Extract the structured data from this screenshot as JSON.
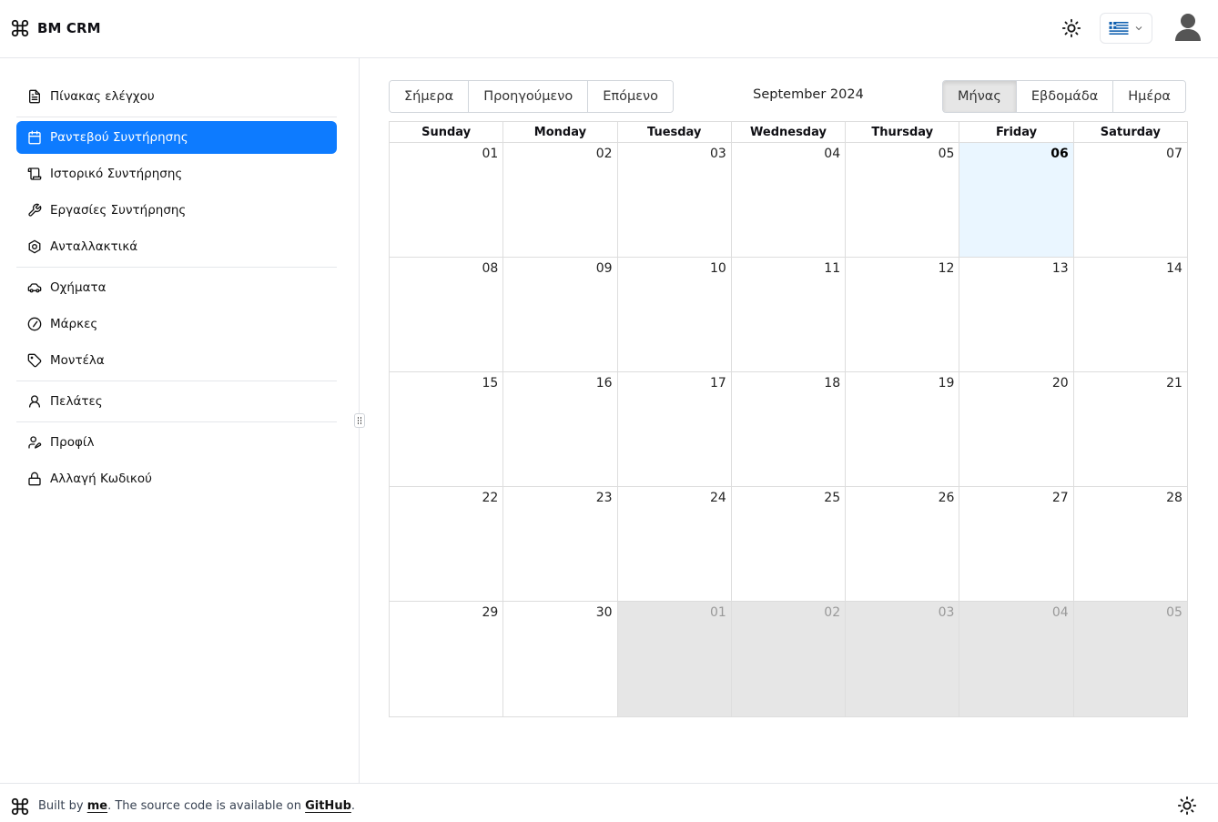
{
  "header": {
    "brand": "BM CRM",
    "theme_icon": "sun-icon",
    "language_icon": "greek-flag-icon",
    "avatar_icon": "user-avatar-icon"
  },
  "sidebar": {
    "items": [
      {
        "label": "Πίνακας ελέγχου",
        "icon": "file-text-icon"
      },
      {
        "label": "Ραντεβού Συντήρησης",
        "icon": "calendar-icon",
        "active": true
      },
      {
        "label": "Ιστορικό Συντήρησης",
        "icon": "scroll-icon"
      },
      {
        "label": "Εργασίες Συντήρησης",
        "icon": "wrench-icon"
      },
      {
        "label": "Ανταλλακτικά",
        "icon": "hexagon-nut-icon"
      },
      {
        "label": "Οχήματα",
        "icon": "car-icon"
      },
      {
        "label": "Μάρκες",
        "icon": "compass-icon"
      },
      {
        "label": "Μοντέλα",
        "icon": "tag-icon"
      },
      {
        "label": "Πελάτες",
        "icon": "user-icon"
      },
      {
        "label": "Προφίλ",
        "icon": "user-pen-icon"
      },
      {
        "label": "Αλλαγή Κωδικού",
        "icon": "lock-icon"
      }
    ]
  },
  "toolbar": {
    "today": "Σήμερα",
    "prev": "Προηγούμενο",
    "next": "Επόμενο",
    "title": "September 2024",
    "views": {
      "month": "Μήνας",
      "week": "Εβδομάδα",
      "day": "Ημέρα"
    },
    "active_view": "month"
  },
  "calendar": {
    "weekdays": [
      "Sunday",
      "Monday",
      "Tuesday",
      "Wednesday",
      "Thursday",
      "Friday",
      "Saturday"
    ],
    "weeks": [
      [
        "01",
        "02",
        "03",
        "04",
        "05",
        "06",
        "07"
      ],
      [
        "08",
        "09",
        "10",
        "11",
        "12",
        "13",
        "14"
      ],
      [
        "15",
        "16",
        "17",
        "18",
        "19",
        "20",
        "21"
      ],
      [
        "22",
        "23",
        "24",
        "25",
        "26",
        "27",
        "28"
      ],
      [
        "29",
        "30",
        "01",
        "02",
        "03",
        "04",
        "05"
      ]
    ],
    "today": "06",
    "accent_color": "#0d7bff",
    "today_bg": "#eaf6ff",
    "off_range_bg": "#e6e6e6"
  },
  "footer": {
    "prefix": "Built by ",
    "author_link": "me",
    "middle": ". The source code is available on ",
    "repo_link": "GitHub",
    "suffix": "."
  }
}
